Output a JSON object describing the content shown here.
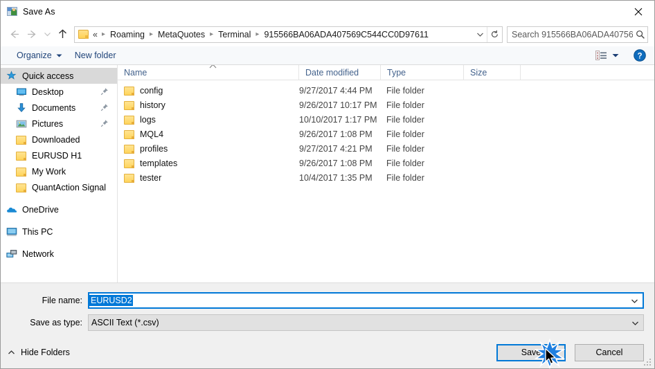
{
  "window": {
    "title": "Save As",
    "icon": "save-as-icon",
    "close_label": "✕"
  },
  "navbar": {
    "back_icon": "back-arrow-icon",
    "forward_icon": "forward-arrow-icon",
    "recent_icon": "recent-locations-chevron-icon",
    "up_icon": "up-arrow-icon",
    "folder_icon": "folder-icon",
    "breadcrumb_prefix": "«",
    "breadcrumbs": [
      "Roaming",
      "MetaQuotes",
      "Terminal",
      "915566BA06ADA407569C544CC0D97611"
    ],
    "separator": "›",
    "dropdown_icon": "chevron-down-icon",
    "refresh_icon": "refresh-icon"
  },
  "search": {
    "placeholder": "Search 915566BA06ADA40756...",
    "icon": "search-icon"
  },
  "command_bar": {
    "organize_label": "Organize",
    "organize_caret": "caret-down-icon",
    "new_folder_label": "New folder",
    "view_icon": "view-layout-icon",
    "view_caret": "caret-down-icon",
    "help_icon": "help-icon",
    "help_label": "?"
  },
  "sidebar": {
    "groups": [
      {
        "header": {
          "label": "Quick access",
          "icon": "star-pin-icon",
          "selected": true
        },
        "items": [
          {
            "label": "Desktop",
            "icon": "desktop-icon",
            "pinned": true
          },
          {
            "label": "Documents",
            "icon": "documents-download-icon",
            "pinned": true
          },
          {
            "label": "Pictures",
            "icon": "pictures-icon",
            "pinned": true
          },
          {
            "label": "Downloaded",
            "icon": "folder-icon",
            "pinned": false
          },
          {
            "label": "EURUSD H1",
            "icon": "folder-icon",
            "pinned": false
          },
          {
            "label": "My Work",
            "icon": "folder-icon",
            "pinned": false
          },
          {
            "label": "QuantAction Signal",
            "icon": "folder-icon",
            "pinned": false
          }
        ]
      },
      {
        "header": {
          "label": "OneDrive",
          "icon": "onedrive-cloud-icon",
          "selected": false
        },
        "items": []
      },
      {
        "header": {
          "label": "This PC",
          "icon": "this-pc-icon",
          "selected": false
        },
        "items": []
      },
      {
        "header": {
          "label": "Network",
          "icon": "network-icon",
          "selected": false
        },
        "items": []
      }
    ]
  },
  "file_list": {
    "columns": [
      "Name",
      "Date modified",
      "Type",
      "Size"
    ],
    "sort_icon": "sort-ascending-caret-icon",
    "rows": [
      {
        "name": "config",
        "date": "9/27/2017 4:44 PM",
        "type": "File folder",
        "size": ""
      },
      {
        "name": "history",
        "date": "9/26/2017 10:17 PM",
        "type": "File folder",
        "size": ""
      },
      {
        "name": "logs",
        "date": "10/10/2017 1:17 PM",
        "type": "File folder",
        "size": ""
      },
      {
        "name": "MQL4",
        "date": "9/26/2017 1:08 PM",
        "type": "File folder",
        "size": ""
      },
      {
        "name": "profiles",
        "date": "9/27/2017 4:21 PM",
        "type": "File folder",
        "size": ""
      },
      {
        "name": "templates",
        "date": "9/26/2017 1:08 PM",
        "type": "File folder",
        "size": ""
      },
      {
        "name": "tester",
        "date": "10/4/2017 1:35 PM",
        "type": "File folder",
        "size": ""
      }
    ]
  },
  "form": {
    "file_name_label": "File name:",
    "file_name_value": "EURUSD2",
    "save_type_label": "Save as type:",
    "save_type_value": "ASCII Text (*.csv)",
    "dropdown_icon": "chevron-down-icon"
  },
  "footer": {
    "hide_folders_label": "Hide Folders",
    "hide_folders_icon": "caret-up-icon",
    "save_label": "Save",
    "cancel_label": "Cancel",
    "cursor_icon": "mouse-pointer-icon",
    "click_burst_icon": "click-burst-icon",
    "resize_grip_icon": "resize-grip-icon"
  },
  "colors": {
    "accent": "#0078d7",
    "folder_yellow": "#ffd45c",
    "selection_grey": "#d9d9d9",
    "header_text": "#43628c",
    "command_text": "#21457a"
  }
}
